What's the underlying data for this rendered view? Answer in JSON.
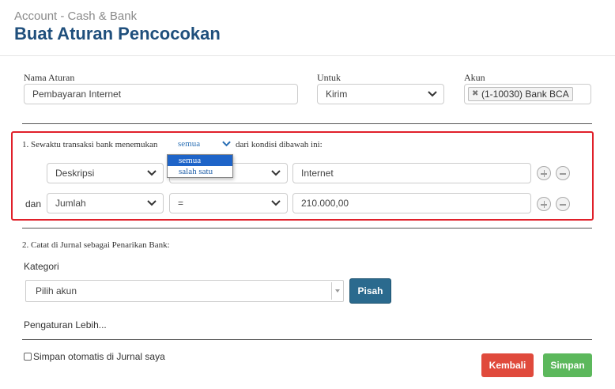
{
  "header": {
    "breadcrumb": "Account - Cash & Bank",
    "title": "Buat Aturan Pencocokan"
  },
  "form": {
    "nama_label": "Nama Aturan",
    "nama_value": "Pembayaran Internet",
    "untuk_label": "Untuk",
    "untuk_value": "Kirim",
    "akun_label": "Akun",
    "akun_tag": "(1-10030) Bank BCA"
  },
  "rules": {
    "intro_before": "1. Sewaktu transaksi bank menemukan",
    "match_value": "semua",
    "intro_after": "dari kondisi dibawah ini:",
    "dropdown_options": [
      "semua",
      "salah satu"
    ],
    "conditions": [
      {
        "connector": "",
        "field": "Deskripsi",
        "operator": "",
        "value": "Internet"
      },
      {
        "connector": "dan",
        "field": "Jumlah",
        "operator": "=",
        "value": "210.000,00"
      }
    ]
  },
  "journal": {
    "heading": "2. Catat di Jurnal sebagai Penarikan Bank:",
    "kategori_label": "Kategori",
    "kategori_placeholder": "Pilih akun",
    "split_label": "Pisah",
    "advanced_label": "Pengaturan Lebih..."
  },
  "footer": {
    "auto_save_label": "Simpan otomatis di Jurnal saya",
    "back_label": "Kembali",
    "save_label": "Simpan"
  },
  "colors": {
    "title": "#1f4f7c",
    "highlight_border": "#e0202a",
    "split_button": "#2b6a8e",
    "back_button": "#e04a3c",
    "save_button": "#5cb85c"
  },
  "icons": {
    "select_caret": "chevron-down-icon",
    "remove_tag": "close-icon",
    "add_condition": "plus-circle-icon",
    "remove_condition": "minus-circle-icon"
  }
}
